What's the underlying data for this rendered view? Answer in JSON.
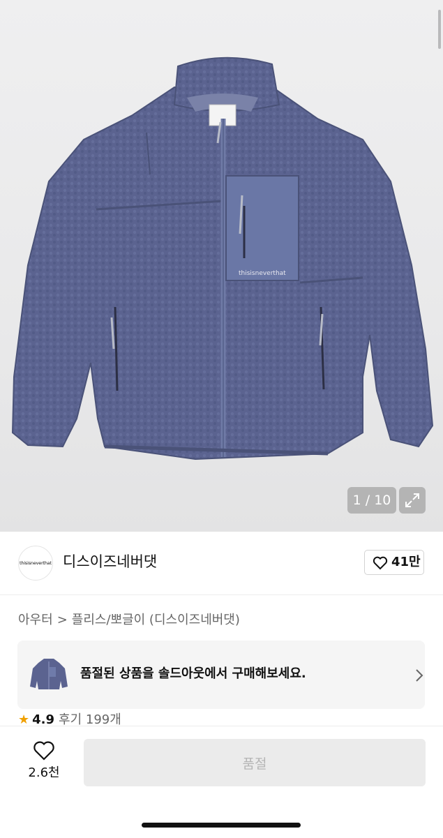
{
  "gallery": {
    "counter": "1 / 10",
    "jacket_brand_text": "thisisneverthat",
    "jacket_color": "#5a638f"
  },
  "seller": {
    "avatar_text": "thisisneverthat",
    "name": "디스이즈네버댓",
    "like_count": "41만"
  },
  "breadcrumb": {
    "category": "아우터",
    "separator": ">",
    "subcategory": "플리스/뽀글이 (디스이즈네버댓)"
  },
  "soldout_banner": {
    "message": "품절된 상품을 솔드아웃에서 구매해보세요."
  },
  "rating": {
    "star": "★",
    "score": "4.9",
    "reviews": "후기 199개"
  },
  "bottom_bar": {
    "wish_count": "2.6천",
    "buy_label": "품절"
  },
  "colors": {
    "accent_star": "#f0a000",
    "disabled_button": "#ebebeb"
  }
}
